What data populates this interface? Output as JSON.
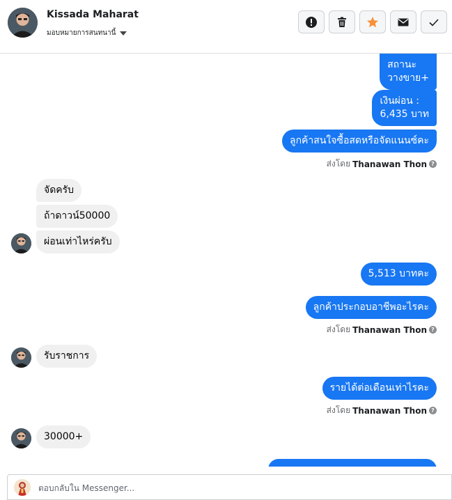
{
  "header": {
    "contact_name": "Kissada Maharat",
    "assign_label": "มอบหมายการสนทนานี้",
    "actions": [
      {
        "icon": "alert-icon",
        "label": "spam"
      },
      {
        "icon": "trash-icon",
        "label": "delete"
      },
      {
        "icon": "star-icon",
        "label": "follow-up"
      },
      {
        "icon": "envelope-icon",
        "label": "mark-unread"
      },
      {
        "icon": "check-icon",
        "label": "done"
      }
    ],
    "star_color": "#f7923a"
  },
  "colors": {
    "outgoing_bubble": "#1877f2",
    "incoming_bubble": "#f0f0f0"
  },
  "messages": [
    {
      "dir": "out",
      "text": "สถานะ\nวางขาย+"
    },
    {
      "dir": "out",
      "text": "เงินผ่อน :\n6,435 บาท"
    },
    {
      "dir": "out",
      "text": "ลูกค้าสนใจซื้อสดหรือจัดแนนซ์คะ"
    },
    {
      "sent_by_prefix": "ส่งโดย",
      "sent_by_name": "Thanawan Thon"
    },
    {
      "dir": "in",
      "text": "จัดครับ"
    },
    {
      "dir": "in",
      "text": "ถ้าดาวน์50000"
    },
    {
      "dir": "in",
      "text": "ผ่อนเท่าไหร่ครับ"
    },
    {
      "dir": "out",
      "text": "5,513 บาทคะ"
    },
    {
      "dir": "out",
      "text": "ลูกค้าประกอบอาชีพอะไรคะ"
    },
    {
      "sent_by_prefix": "ส่งโดย",
      "sent_by_name": "Thanawan Thon"
    },
    {
      "dir": "in",
      "text": "รับราชการ"
    },
    {
      "dir": "out",
      "text": "รายได้ต่อเดือนเท่าไรคะ"
    },
    {
      "sent_by_prefix": "ส่งโดย",
      "sent_by_name": "Thanawan Thon"
    },
    {
      "dir": "in",
      "text": "30000+"
    }
  ],
  "composer": {
    "placeholder": "ตอบกลับใน Messenger..."
  }
}
